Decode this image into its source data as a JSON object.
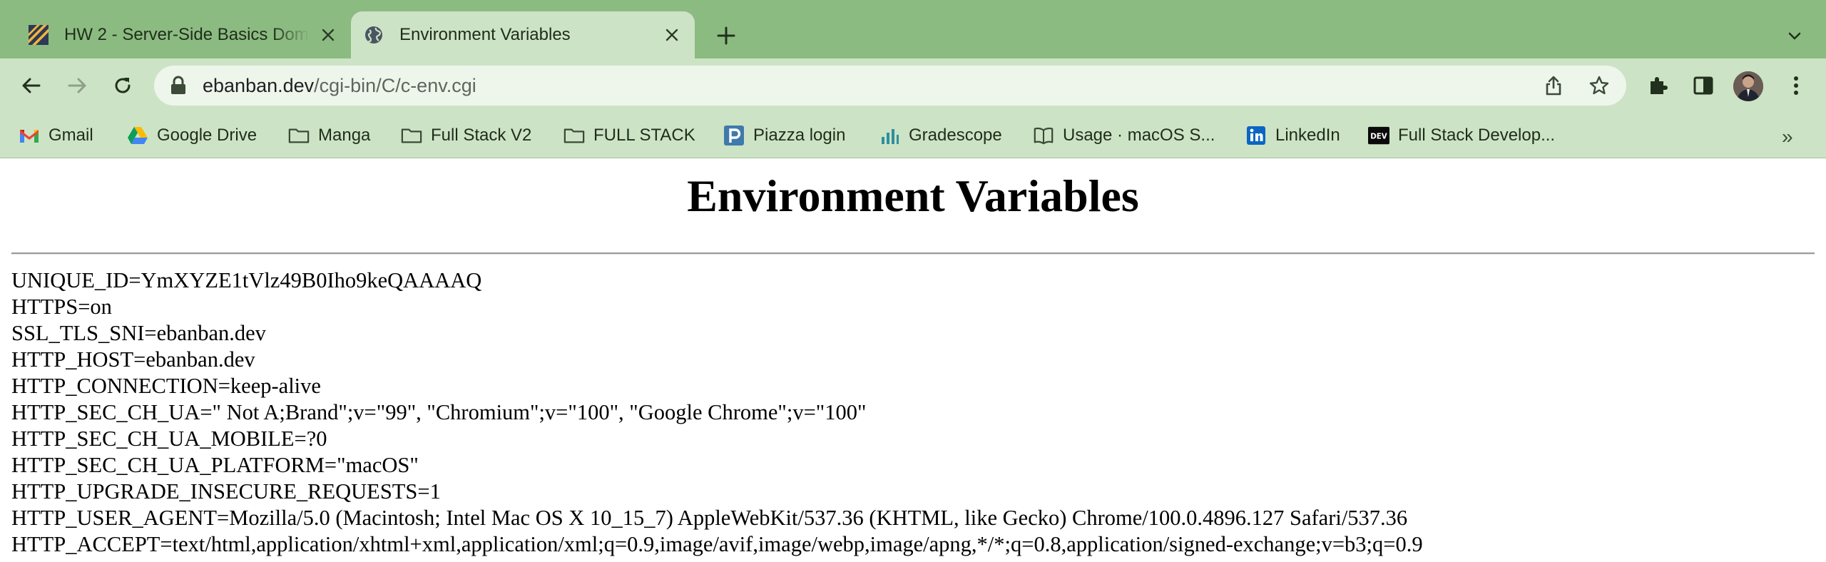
{
  "browser": {
    "tabs": [
      {
        "title": "HW 2 - Server-Side Basics Doma",
        "favicon": "canvas-stripes-icon",
        "active": false
      },
      {
        "title": "Environment Variables",
        "favicon": "globe-icon",
        "active": true
      }
    ],
    "address_bar": {
      "domain": "ebanban.dev",
      "path": "/cgi-bin/C/c-env.cgi"
    },
    "bookmarks": [
      {
        "label": "Gmail",
        "icon": "gmail-icon"
      },
      {
        "label": "Google Drive",
        "icon": "google-drive-icon"
      },
      {
        "label": "Manga",
        "icon": "folder-icon"
      },
      {
        "label": "Full Stack V2",
        "icon": "folder-icon"
      },
      {
        "label": "FULL STACK",
        "icon": "folder-icon"
      },
      {
        "label": "Piazza login",
        "icon": "piazza-icon"
      },
      {
        "label": "Gradescope",
        "icon": "gradescope-icon"
      },
      {
        "label": "Usage · macOS S...",
        "icon": "book-icon"
      },
      {
        "label": "LinkedIn",
        "icon": "linkedin-icon"
      },
      {
        "label": "Full Stack Develop...",
        "icon": "dev-icon"
      }
    ],
    "bookmarks_overflow": "»",
    "colors": {
      "frame": "#8cbb81",
      "toolbar": "#cde3c5",
      "omnibox": "#eef5eb"
    }
  },
  "page": {
    "title": "Environment Variables",
    "env_lines": [
      "UNIQUE_ID=YmXYZE1tVlz49B0Iho9keQAAAAQ",
      "HTTPS=on",
      "SSL_TLS_SNI=ebanban.dev",
      "HTTP_HOST=ebanban.dev",
      "HTTP_CONNECTION=keep-alive",
      "HTTP_SEC_CH_UA=\" Not A;Brand\";v=\"99\", \"Chromium\";v=\"100\", \"Google Chrome\";v=\"100\"",
      "HTTP_SEC_CH_UA_MOBILE=?0",
      "HTTP_SEC_CH_UA_PLATFORM=\"macOS\"",
      "HTTP_UPGRADE_INSECURE_REQUESTS=1",
      "HTTP_USER_AGENT=Mozilla/5.0 (Macintosh; Intel Mac OS X 10_15_7) AppleWebKit/537.36 (KHTML, like Gecko) Chrome/100.0.4896.127 Safari/537.36",
      "HTTP_ACCEPT=text/html,application/xhtml+xml,application/xml;q=0.9,image/avif,image/webp,image/apng,*/*;q=0.8,application/signed-exchange;v=b3;q=0.9"
    ]
  }
}
